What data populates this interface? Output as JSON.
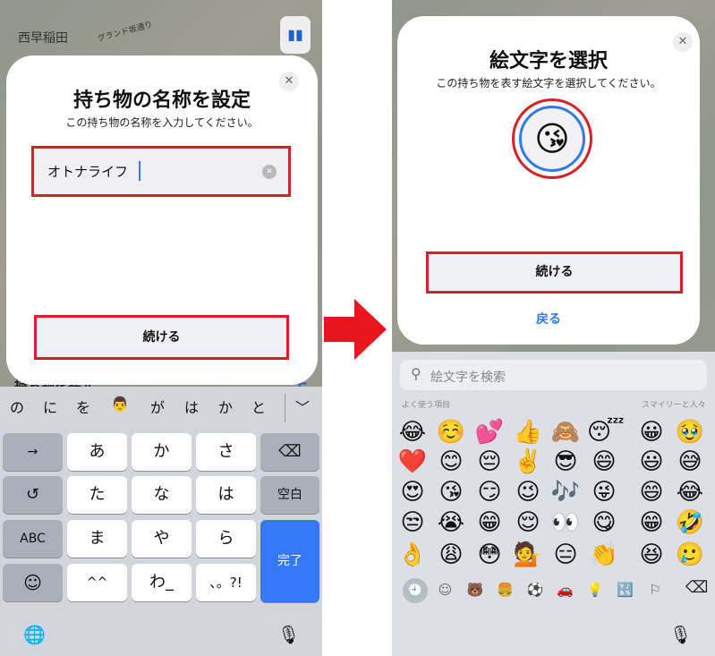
{
  "left": {
    "map": {
      "area_label": "西早稲田",
      "street_label": "グランド坂通り",
      "behind_title": "持ち物を探す",
      "plus": "+"
    },
    "dialog": {
      "title": "持ち物の名称を設定",
      "subtitle": "この持ち物の名称を入力してください。",
      "input_value": "オトナライフ",
      "close": "✕",
      "clear": "✕",
      "continue_label": "続ける"
    },
    "keyboard": {
      "candidates": [
        "の",
        "に",
        "を",
        "👨",
        "が",
        "は",
        "か",
        "と"
      ],
      "collapse": "﹀",
      "rows": [
        [
          "→",
          "あ",
          "か",
          "さ",
          "⌫"
        ],
        [
          "↺",
          "た",
          "な",
          "は",
          "空白"
        ],
        [
          "ABC",
          "ま",
          "や",
          "ら"
        ],
        [
          "☺",
          "^^",
          "わ_",
          "、。?!"
        ]
      ],
      "done_label": "完了",
      "done_color": "#3478f6",
      "globe": "🌐",
      "mic": "🎙"
    }
  },
  "right": {
    "dialog": {
      "title": "絵文字を選択",
      "subtitle": "この持ち物を表す絵文字を選択してください。",
      "selected_emoji": "😘",
      "close": "✕",
      "continue_label": "続ける",
      "back_label": "戻る",
      "accent": "#3478f6"
    },
    "emoji_keyboard": {
      "search_placeholder": "絵文字を検索",
      "section_frequent": "よく使う項目",
      "section_smileys": "スマイリーと人々",
      "frequent": [
        [
          "😂",
          "☺️",
          "💕",
          "👍",
          "🙈",
          "😴"
        ],
        [
          "❤️",
          "😊",
          "😔",
          "✌️",
          "😎",
          "😄"
        ],
        [
          "😍",
          "😘",
          "😏",
          "😉",
          "🎶",
          "😜"
        ],
        [
          "😒",
          "😭",
          "😁",
          "😌",
          "👀",
          "😋"
        ],
        [
          "👌",
          "😩",
          "😳",
          "💁",
          "😑",
          "👏"
        ]
      ],
      "smileys": [
        [
          "😀",
          "🥹"
        ],
        [
          "😃",
          "😅"
        ],
        [
          "😄",
          "😂"
        ],
        [
          "😁",
          "🤣"
        ],
        [
          "😆",
          "🥲"
        ]
      ],
      "categories": [
        "🕘",
        "☺",
        "🐻",
        "🍔",
        "⚽",
        "🚗",
        "💡",
        "🔣",
        "⚐"
      ],
      "delete": "⌫",
      "mic": "🎙"
    }
  },
  "arrow_color": "#e8171f"
}
